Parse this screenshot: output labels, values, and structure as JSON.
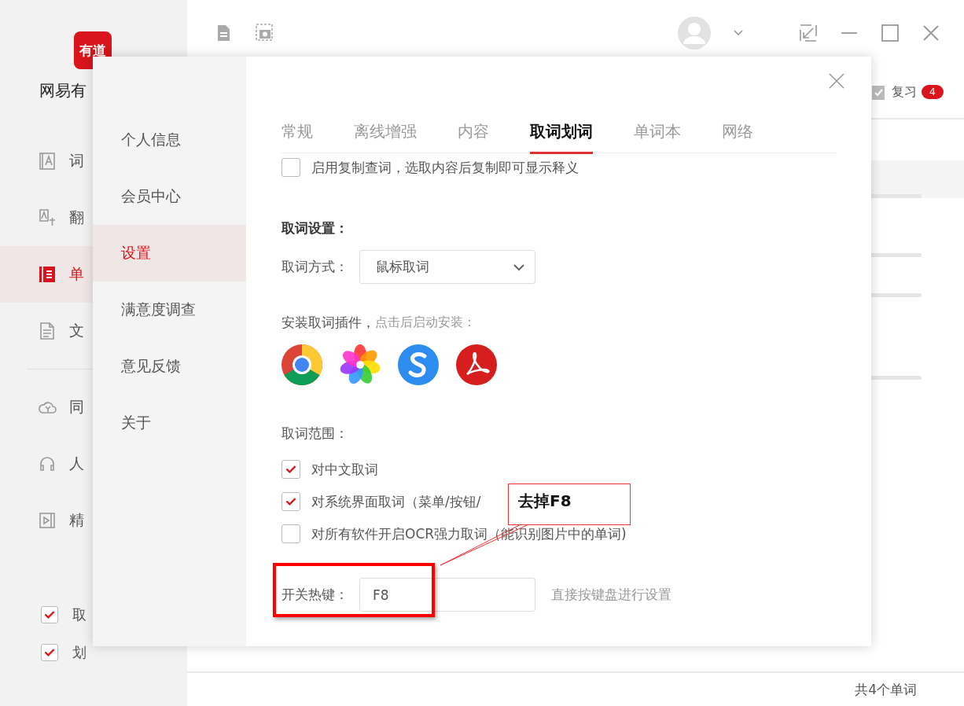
{
  "app": {
    "logo": "有道",
    "name": "网易有",
    "nav": [
      {
        "label": "词",
        "selected": false
      },
      {
        "label": "翻",
        "selected": false
      },
      {
        "label": "单",
        "selected": true
      },
      {
        "label": "文",
        "selected": false
      }
    ],
    "nav2": [
      {
        "label": "同"
      },
      {
        "label": "人"
      },
      {
        "label": "精"
      }
    ],
    "toggles": [
      {
        "label": "取",
        "checked": true
      },
      {
        "label": "划",
        "checked": true
      }
    ]
  },
  "main": {
    "review": {
      "label": "复习",
      "count": "4"
    },
    "status": "共4个单词"
  },
  "dialog": {
    "nav": [
      {
        "label": "个人信息",
        "selected": false
      },
      {
        "label": "会员中心",
        "selected": false
      },
      {
        "label": "设置",
        "selected": true
      },
      {
        "label": "满意度调查",
        "selected": false
      },
      {
        "label": "意见反馈",
        "selected": false
      },
      {
        "label": "关于",
        "selected": false
      }
    ],
    "tabs": [
      {
        "label": "常规",
        "selected": false
      },
      {
        "label": "离线增强",
        "selected": false
      },
      {
        "label": "内容",
        "selected": false
      },
      {
        "label": "取词划词",
        "selected": true
      },
      {
        "label": "单词本",
        "selected": false
      },
      {
        "label": "网络",
        "selected": false
      }
    ],
    "copy_lookup": {
      "label": "启用复制查词，选取内容后复制即可显示释义",
      "checked": false
    },
    "section_title": "取词设置：",
    "mode": {
      "label": "取词方式：",
      "value": "鼠标取词"
    },
    "plugins": {
      "label": "安装取词插件，",
      "hint": "点击后启动安装："
    },
    "range": {
      "title": "取词范围：",
      "options": [
        {
          "label": "对中文取词",
          "checked": true
        },
        {
          "label": "对系统界面取词（菜单/按钮/",
          "checked": true
        },
        {
          "label": "对所有软件开启OCR强力取词（能识别图片中的单词)",
          "checked": false
        }
      ]
    },
    "hotkey": {
      "label": "开关热键：",
      "value": "F8",
      "hint": "直接按键盘进行设置"
    }
  },
  "annotation": {
    "text": "去掉F8"
  }
}
